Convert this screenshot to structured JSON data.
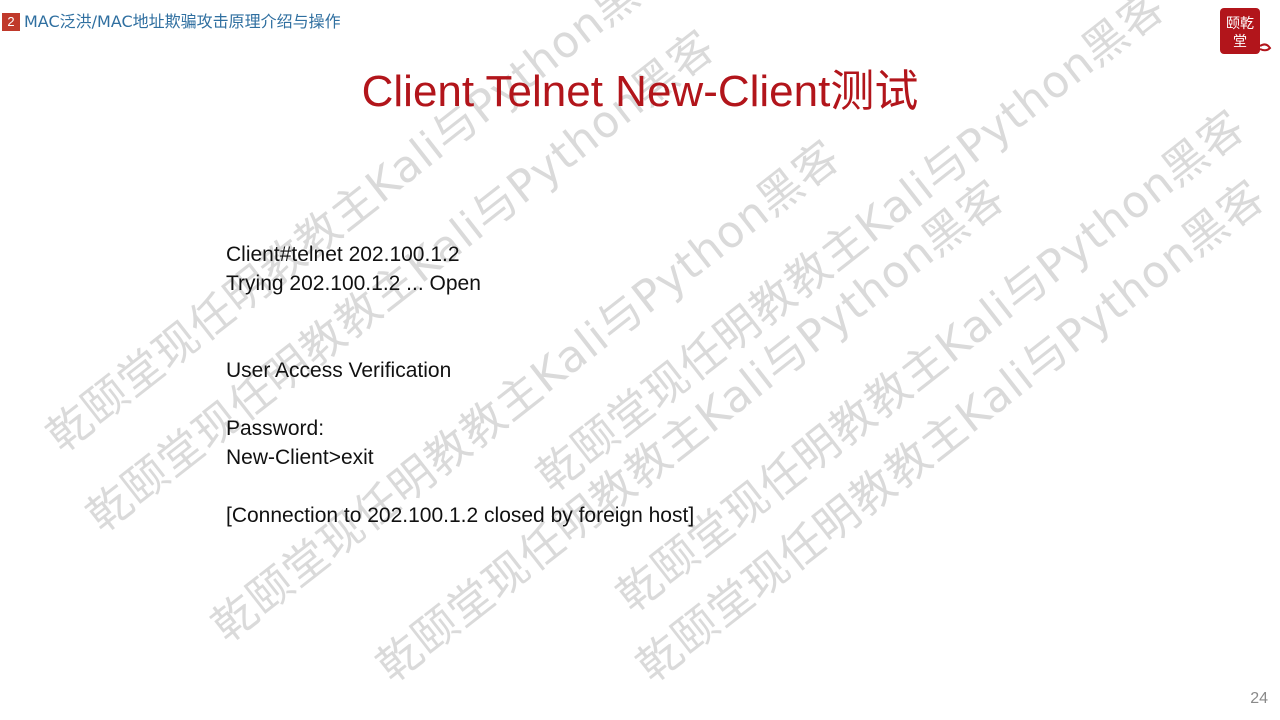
{
  "header": {
    "section_number": "2",
    "section_title": "MAC泛洪/MAC地址欺骗攻击原理介绍与操作"
  },
  "logo": {
    "text": "颐乾堂",
    "color": "#b2151b"
  },
  "title": "Client Telnet New-Client测试",
  "terminal_lines": {
    "l1": "Client#telnet 202.100.1.2",
    "l2": "Trying 202.100.1.2 ... Open",
    "l3": "User Access Verification",
    "l4": "Password:",
    "l5": "New-Client>exit",
    "l6": "[Connection to 202.100.1.2 closed by foreign host]"
  },
  "watermark_text": "乾颐堂现任明教教主Kali与Python黑客",
  "page_number": "24",
  "colors": {
    "title": "#b2151b",
    "header_link": "#2f6fa0",
    "badge": "#c0392b"
  }
}
